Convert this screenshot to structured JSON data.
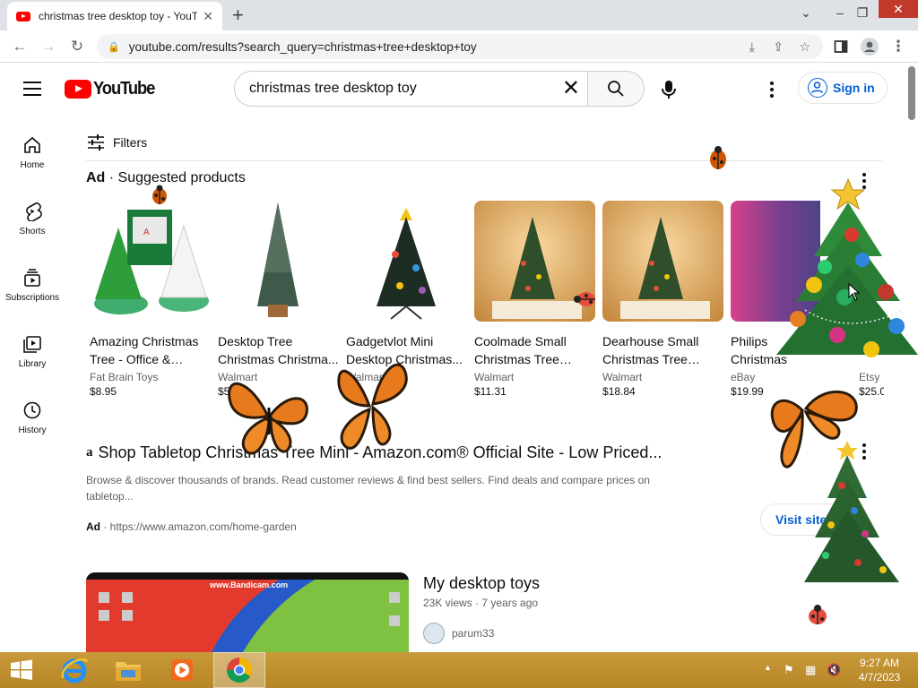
{
  "browser": {
    "tab_title": "christmas tree desktop toy - YouTube",
    "new_tab": "+",
    "url": "youtube.com/results?search_query=christmas+tree+desktop+toy"
  },
  "youtube": {
    "logo_text": "YouTube",
    "search_value": "christmas tree desktop toy",
    "signin_label": "Sign in",
    "accent": "#ff0000",
    "link_color": "#065fd4"
  },
  "sidebar": {
    "items": [
      {
        "label": "Home",
        "icon": "home-icon"
      },
      {
        "label": "Shorts",
        "icon": "shorts-icon"
      },
      {
        "label": "Subscriptions",
        "icon": "subscriptions-icon"
      },
      {
        "label": "Library",
        "icon": "library-icon"
      },
      {
        "label": "History",
        "icon": "history-icon"
      }
    ]
  },
  "filters_label": "Filters",
  "ads": {
    "badge": "Ad",
    "section_title": "Suggested products",
    "products": [
      {
        "name": "Amazing Christmas Tree - Office & Desk...",
        "store": "Fat Brain Toys",
        "price": "$8.95"
      },
      {
        "name": "Desktop Tree Christmas Christma...",
        "store": "Walmart",
        "price": "$5.19"
      },
      {
        "name": "Gadgetvlot Mini Desktop Christmas...",
        "store": "Walmart",
        "price": "$21"
      },
      {
        "name": "Coolmade Small Christmas Tree with...",
        "store": "Walmart",
        "price": "$11.31"
      },
      {
        "name": "Dearhouse Small Christmas Tree with...",
        "store": "Walmart",
        "price": "$18.84"
      },
      {
        "name": "Philips Christmas",
        "store": "eBay",
        "price": "$19.99"
      },
      {
        "name": "",
        "store": "Etsy",
        "price": "$25.0"
      }
    ]
  },
  "amazon_ad": {
    "logo": "a",
    "title": "Shop Tabletop Christmas Tree Mini - Amazon.com® Official Site - Low Priced...",
    "description": "Browse & discover thousands of brands. Read customer reviews & find best sellers. Find deals and compare prices on tabletop...",
    "badge": "Ad",
    "url": "https://www.amazon.com/home-garden",
    "visit_label": "Visit site"
  },
  "video": {
    "title": "My desktop toys",
    "meta": "23K views · 7 years ago",
    "channel": "parum33",
    "watermark": "www.Bandicam.com"
  },
  "taskbar": {
    "time": "9:27 AM",
    "date": "4/7/2023"
  }
}
